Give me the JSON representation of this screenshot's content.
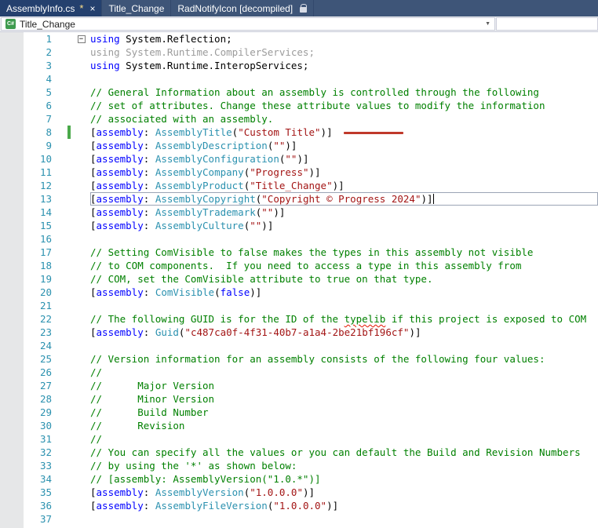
{
  "tabs": [
    {
      "label": "AssemblyInfo.cs",
      "modified": true,
      "active": true
    },
    {
      "label": "Title_Change",
      "modified": false,
      "active": false
    },
    {
      "label": "RadNotifyIcon [decompiled]",
      "modified": false,
      "active": false,
      "readonly": true
    }
  ],
  "icons": {
    "modified": "*",
    "close": "×",
    "chevron": "▼",
    "fold": "−",
    "csharp": "C#"
  },
  "navbar": {
    "project": "Title_Change"
  },
  "colors": {
    "keyword": "#0000ff",
    "type": "#2b91af",
    "string": "#a31515",
    "comment": "#008000",
    "unused_using": "#9b9b9b",
    "line_number": "#2b91af",
    "tabbar_background": "#3e5578",
    "active_tab_background": "#24406e",
    "change_tracking_green": "#4aa94a",
    "annotation_red": "#c0392b"
  },
  "editor": {
    "lines": [
      {
        "n": 1,
        "fold": true,
        "seg": [
          [
            "kw",
            "using"
          ],
          [
            "pl",
            " System.Reflection;"
          ]
        ]
      },
      {
        "n": 2,
        "seg": [
          [
            "gr",
            "using System.Runtime.CompilerServices;"
          ]
        ]
      },
      {
        "n": 3,
        "seg": [
          [
            "kw",
            "using"
          ],
          [
            "pl",
            " System.Runtime.InteropServices;"
          ]
        ]
      },
      {
        "n": 4,
        "seg": []
      },
      {
        "n": 5,
        "seg": [
          [
            "cm",
            "// General Information about an assembly is controlled through the following"
          ]
        ]
      },
      {
        "n": 6,
        "seg": [
          [
            "cm",
            "// set of attributes. Change these attribute values to modify the information"
          ]
        ]
      },
      {
        "n": 7,
        "seg": [
          [
            "cm",
            "// associated with an assembly."
          ]
        ]
      },
      {
        "n": 8,
        "change": true,
        "redline": true,
        "seg": [
          [
            "pl",
            "["
          ],
          [
            "kw",
            "assembly"
          ],
          [
            "pl",
            ": "
          ],
          [
            "ty",
            "AssemblyTitle"
          ],
          [
            "pl",
            "("
          ],
          [
            "st",
            "\"Custom Title\""
          ],
          [
            "pl",
            ")]"
          ]
        ]
      },
      {
        "n": 9,
        "seg": [
          [
            "pl",
            "["
          ],
          [
            "kw",
            "assembly"
          ],
          [
            "pl",
            ": "
          ],
          [
            "ty",
            "AssemblyDescription"
          ],
          [
            "pl",
            "("
          ],
          [
            "st",
            "\"\""
          ],
          [
            "pl",
            ")]"
          ]
        ]
      },
      {
        "n": 10,
        "seg": [
          [
            "pl",
            "["
          ],
          [
            "kw",
            "assembly"
          ],
          [
            "pl",
            ": "
          ],
          [
            "ty",
            "AssemblyConfiguration"
          ],
          [
            "pl",
            "("
          ],
          [
            "st",
            "\"\""
          ],
          [
            "pl",
            ")]"
          ]
        ]
      },
      {
        "n": 11,
        "seg": [
          [
            "pl",
            "["
          ],
          [
            "kw",
            "assembly"
          ],
          [
            "pl",
            ": "
          ],
          [
            "ty",
            "AssemblyCompany"
          ],
          [
            "pl",
            "("
          ],
          [
            "st",
            "\"Progress\""
          ],
          [
            "pl",
            ")]"
          ]
        ]
      },
      {
        "n": 12,
        "seg": [
          [
            "pl",
            "["
          ],
          [
            "kw",
            "assembly"
          ],
          [
            "pl",
            ": "
          ],
          [
            "ty",
            "AssemblyProduct"
          ],
          [
            "pl",
            "("
          ],
          [
            "st",
            "\"Title_Change\""
          ],
          [
            "pl",
            ")]"
          ]
        ]
      },
      {
        "n": 13,
        "current": true,
        "cursor": true,
        "seg": [
          [
            "pl",
            "["
          ],
          [
            "kw",
            "assembly"
          ],
          [
            "pl",
            ": "
          ],
          [
            "ty",
            "AssemblyCopyright"
          ],
          [
            "pl",
            "("
          ],
          [
            "st",
            "\"Copyright © Progress 2024\""
          ],
          [
            "pl",
            ")]"
          ]
        ]
      },
      {
        "n": 14,
        "seg": [
          [
            "pl",
            "["
          ],
          [
            "kw",
            "assembly"
          ],
          [
            "pl",
            ": "
          ],
          [
            "ty",
            "AssemblyTrademark"
          ],
          [
            "pl",
            "("
          ],
          [
            "st",
            "\"\""
          ],
          [
            "pl",
            ")]"
          ]
        ]
      },
      {
        "n": 15,
        "seg": [
          [
            "pl",
            "["
          ],
          [
            "kw",
            "assembly"
          ],
          [
            "pl",
            ": "
          ],
          [
            "ty",
            "AssemblyCulture"
          ],
          [
            "pl",
            "("
          ],
          [
            "st",
            "\"\""
          ],
          [
            "pl",
            ")]"
          ]
        ]
      },
      {
        "n": 16,
        "seg": []
      },
      {
        "n": 17,
        "seg": [
          [
            "cm",
            "// Setting ComVisible to false makes the types in this assembly not visible"
          ]
        ]
      },
      {
        "n": 18,
        "seg": [
          [
            "cm",
            "// to COM components.  If you need to access a type in this assembly from"
          ]
        ]
      },
      {
        "n": 19,
        "seg": [
          [
            "cm",
            "// COM, set the ComVisible attribute to true on that type."
          ]
        ]
      },
      {
        "n": 20,
        "seg": [
          [
            "pl",
            "["
          ],
          [
            "kw",
            "assembly"
          ],
          [
            "pl",
            ": "
          ],
          [
            "ty",
            "ComVisible"
          ],
          [
            "pl",
            "("
          ],
          [
            "kw",
            "false"
          ],
          [
            "pl",
            ")]"
          ]
        ]
      },
      {
        "n": 21,
        "seg": []
      },
      {
        "n": 22,
        "seg": [
          [
            "cm",
            "// The following GUID is for the ID of the "
          ],
          [
            "cm sq",
            "typelib"
          ],
          [
            "cm",
            " if this project is exposed to COM"
          ]
        ]
      },
      {
        "n": 23,
        "seg": [
          [
            "pl",
            "["
          ],
          [
            "kw",
            "assembly"
          ],
          [
            "pl",
            ": "
          ],
          [
            "ty",
            "Guid"
          ],
          [
            "pl",
            "("
          ],
          [
            "st",
            "\"c487ca0f-4f31-40b7-a1a4-2be21bf196cf\""
          ],
          [
            "pl",
            ")]"
          ]
        ]
      },
      {
        "n": 24,
        "seg": []
      },
      {
        "n": 25,
        "seg": [
          [
            "cm",
            "// Version information for an assembly consists of the following four values:"
          ]
        ]
      },
      {
        "n": 26,
        "seg": [
          [
            "cm",
            "//"
          ]
        ]
      },
      {
        "n": 27,
        "seg": [
          [
            "cm",
            "//      Major Version"
          ]
        ]
      },
      {
        "n": 28,
        "seg": [
          [
            "cm",
            "//      Minor Version"
          ]
        ]
      },
      {
        "n": 29,
        "seg": [
          [
            "cm",
            "//      Build Number"
          ]
        ]
      },
      {
        "n": 30,
        "seg": [
          [
            "cm",
            "//      Revision"
          ]
        ]
      },
      {
        "n": 31,
        "seg": [
          [
            "cm",
            "//"
          ]
        ]
      },
      {
        "n": 32,
        "seg": [
          [
            "cm",
            "// You can specify all the values or you can default the Build and Revision Numbers"
          ]
        ]
      },
      {
        "n": 33,
        "seg": [
          [
            "cm",
            "// by using the '*' as shown below:"
          ]
        ]
      },
      {
        "n": 34,
        "seg": [
          [
            "cm",
            "// [assembly: AssemblyVersion(\"1.0.*\")]"
          ]
        ]
      },
      {
        "n": 35,
        "seg": [
          [
            "pl",
            "["
          ],
          [
            "kw",
            "assembly"
          ],
          [
            "pl",
            ": "
          ],
          [
            "ty",
            "AssemblyVersion"
          ],
          [
            "pl",
            "("
          ],
          [
            "st",
            "\"1.0.0.0\""
          ],
          [
            "pl",
            ")]"
          ]
        ]
      },
      {
        "n": 36,
        "seg": [
          [
            "pl",
            "["
          ],
          [
            "kw",
            "assembly"
          ],
          [
            "pl",
            ": "
          ],
          [
            "ty",
            "AssemblyFileVersion"
          ],
          [
            "pl",
            "("
          ],
          [
            "st",
            "\"1.0.0.0\""
          ],
          [
            "pl",
            ")]"
          ]
        ]
      },
      {
        "n": 37,
        "seg": []
      }
    ]
  }
}
